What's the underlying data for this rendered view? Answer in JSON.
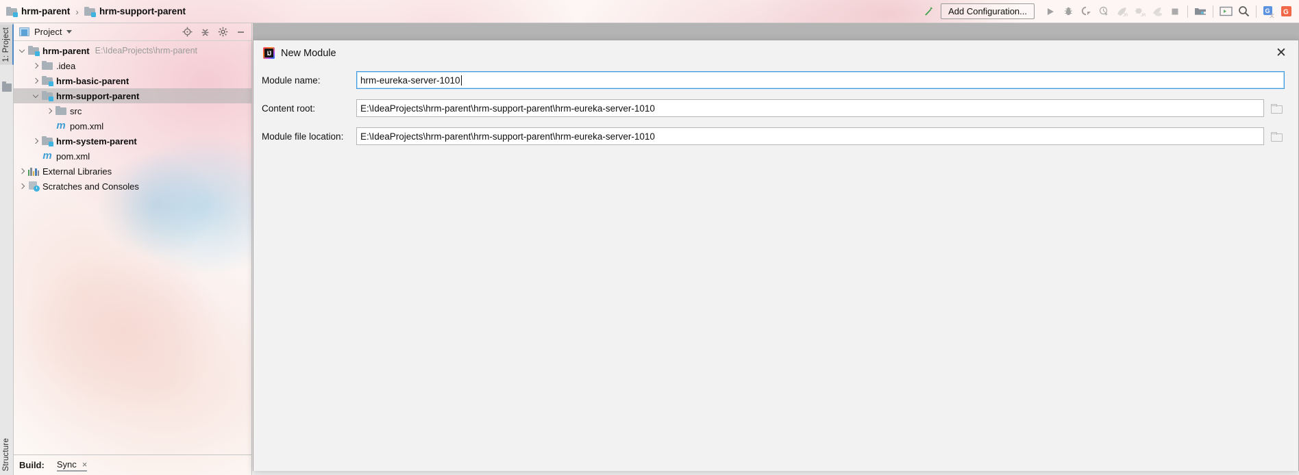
{
  "breadcrumbs": [
    {
      "label": "hrm-parent",
      "icon": "module-folder-icon"
    },
    {
      "label": "hrm-support-parent",
      "icon": "module-folder-icon"
    }
  ],
  "breadcrumb_separator": "›",
  "toolbar": {
    "build_icon": "hammer-icon",
    "add_configuration_label": "Add Configuration...",
    "buttons": [
      {
        "name": "run-button",
        "icon": "play-icon"
      },
      {
        "name": "debug-button",
        "icon": "bug-icon"
      },
      {
        "name": "run-with-coverage-button",
        "icon": "coverage-icon"
      },
      {
        "name": "profile-button",
        "icon": "clock-cursor-icon"
      },
      {
        "name": "jrebel-run-button",
        "icon": "rocket-jr-icon"
      },
      {
        "name": "jrebel-debug-button",
        "icon": "bug-jr-icon"
      },
      {
        "name": "xrebel-button",
        "icon": "rocket-cloud-icon"
      },
      {
        "name": "stop-button",
        "icon": "stop-square-icon"
      },
      {
        "name": "project-structure-button",
        "icon": "project-structure-icon"
      },
      {
        "name": "terminal-button",
        "icon": "terminal-icon"
      },
      {
        "name": "search-everywhere-button",
        "icon": "search-icon"
      },
      {
        "name": "google-translate-button",
        "icon": "translate-icon"
      },
      {
        "name": "grep-console-button",
        "icon": "grep-icon"
      }
    ]
  },
  "vertical_tabs": {
    "project": "1: Project",
    "structure": "Structure"
  },
  "project_panel": {
    "title": "Project",
    "tools": [
      {
        "name": "select-opened-file-button",
        "icon": "locate-target-icon"
      },
      {
        "name": "collapse-all-button",
        "icon": "collapse-all-icon"
      },
      {
        "name": "settings-button",
        "icon": "gear-icon"
      },
      {
        "name": "hide-button",
        "icon": "minimize-icon"
      }
    ],
    "tree": [
      {
        "label": "hrm-parent",
        "path": "E:\\IdeaProjects\\hrm-parent",
        "icon": "module-folder-icon",
        "indent": 0,
        "arrow": "down",
        "bold": true,
        "selected": false
      },
      {
        "label": ".idea",
        "path": "",
        "icon": "folder-icon",
        "indent": 1,
        "arrow": "right",
        "bold": false,
        "selected": false
      },
      {
        "label": "hrm-basic-parent",
        "path": "",
        "icon": "module-folder-icon",
        "indent": 1,
        "arrow": "right",
        "bold": true,
        "selected": false
      },
      {
        "label": "hrm-support-parent",
        "path": "",
        "icon": "module-folder-icon",
        "indent": 1,
        "arrow": "down",
        "bold": true,
        "selected": true
      },
      {
        "label": "src",
        "path": "",
        "icon": "folder-icon",
        "indent": 2,
        "arrow": "right",
        "bold": false,
        "selected": false
      },
      {
        "label": "pom.xml",
        "path": "",
        "icon": "maven-icon",
        "indent": 2,
        "arrow": "none",
        "bold": false,
        "selected": false
      },
      {
        "label": "hrm-system-parent",
        "path": "",
        "icon": "module-folder-icon",
        "indent": 1,
        "arrow": "right",
        "bold": true,
        "selected": false
      },
      {
        "label": "pom.xml",
        "path": "",
        "icon": "maven-icon",
        "indent": 1,
        "arrow": "none",
        "bold": false,
        "selected": false
      },
      {
        "label": "External Libraries",
        "path": "",
        "icon": "libraries-icon",
        "indent": 0,
        "arrow": "right",
        "bold": false,
        "selected": false
      },
      {
        "label": "Scratches and Consoles",
        "path": "",
        "icon": "scratches-icon",
        "indent": 0,
        "arrow": "right",
        "bold": false,
        "selected": false
      }
    ]
  },
  "build_bar": {
    "label": "Build:",
    "tab": "Sync",
    "close": "×"
  },
  "dialog": {
    "title": "New Module",
    "logo": "intellij-idea-icon",
    "close": "✕",
    "fields": [
      {
        "label": "Module name:",
        "value": "hrm-eureka-server-1010",
        "focused": true,
        "has_browse": false
      },
      {
        "label": "Content root:",
        "value": "E:\\IdeaProjects\\hrm-parent\\hrm-support-parent\\hrm-eureka-server-1010",
        "focused": false,
        "has_browse": true
      },
      {
        "label": "Module file location:",
        "value": "E:\\IdeaProjects\\hrm-parent\\hrm-support-parent\\hrm-eureka-server-1010",
        "focused": false,
        "has_browse": true
      }
    ]
  },
  "colors": {
    "accent_blue": "#3f9ae0",
    "selection_gray": "#b4b4b4",
    "maven_blue": "#3f9ed4",
    "folder_badge": "#3eb3e0",
    "hammer_green": "#3f9e4d"
  }
}
